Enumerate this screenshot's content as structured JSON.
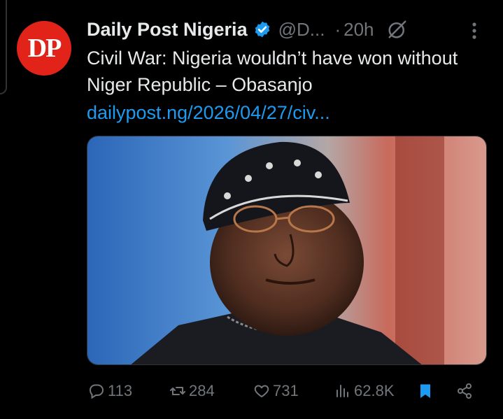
{
  "tweet": {
    "avatar_text": "DP",
    "display_name": "Daily Post Nigeria",
    "handle": "@D...",
    "separator": "·",
    "time": "20h",
    "text": "Civil War: Nigeria wouldn’t have won without Niger Republic – Obasanjo",
    "link": "dailypost.ng/2026/04/27/civ..."
  },
  "media": {
    "description_icon": "photo"
  },
  "actions": {
    "reply_count": "113",
    "retweet_count": "284",
    "like_count": "731",
    "view_count": "62.8K"
  },
  "colors": {
    "background": "#000000",
    "text": "#e7e9ea",
    "muted": "#71767b",
    "link": "#1d9bf0",
    "avatar": "#e2231a",
    "bookmark": "#1d9bf0"
  },
  "icons": [
    "verified-icon",
    "grok-icon",
    "more-icon",
    "reply-icon",
    "retweet-icon",
    "like-icon",
    "views-icon",
    "bookmark-icon",
    "share-icon"
  ]
}
